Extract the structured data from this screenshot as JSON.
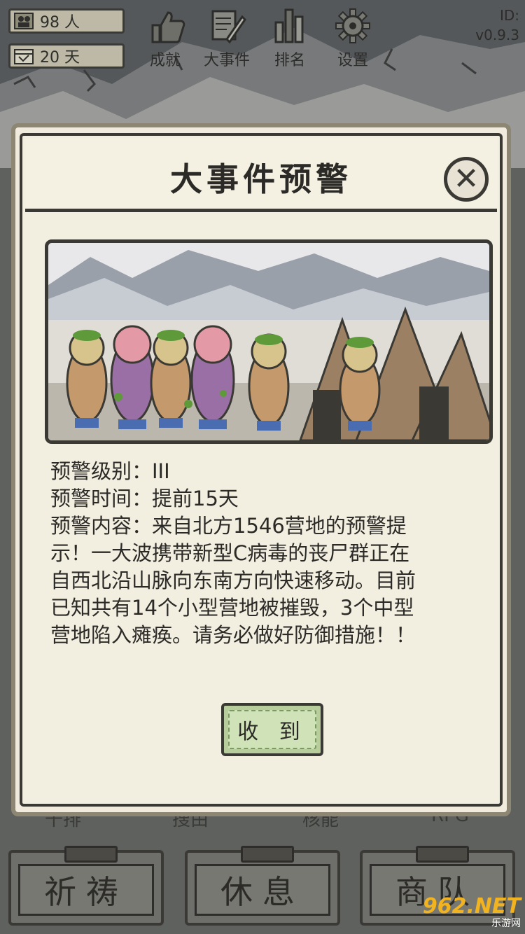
{
  "stats": {
    "population": "98 人",
    "days": "20 天"
  },
  "top_nav": [
    {
      "label": "成就",
      "icon": "thumbs-up-icon"
    },
    {
      "label": "大事件",
      "icon": "scroll-quill-icon"
    },
    {
      "label": "排名",
      "icon": "bar-ranking-icon"
    },
    {
      "label": "设置",
      "icon": "gear-icon"
    }
  ],
  "version": {
    "id_label": "ID:",
    "version": "v0.9.3"
  },
  "modal": {
    "title": "大事件预警",
    "lines": [
      "预警级别：III",
      "预警时间：提前15天",
      "预警内容：来自北方1546营地的预警提",
      "示！一大波携带新型C病毒的丧尸群正在",
      "自西北沿山脉向东南方向快速移动。目前",
      "已知共有14个小型营地被摧毁，3个中型",
      "营地陷入瘫痪。请务必做好防御措施！！"
    ],
    "confirm_label": "收 到"
  },
  "partial_labels": [
    "干排",
    "搜由",
    "核能",
    "RPG"
  ],
  "bottom_buttons": [
    "祈祷",
    "休息",
    "商队"
  ],
  "watermark": {
    "brand": "962.NET",
    "sub": "乐游网"
  },
  "colors": {
    "parchment": "#f0ebdc",
    "ink": "#2b2a27",
    "confirm_green": "#cfe2b8",
    "background_stone": "#56595a"
  }
}
